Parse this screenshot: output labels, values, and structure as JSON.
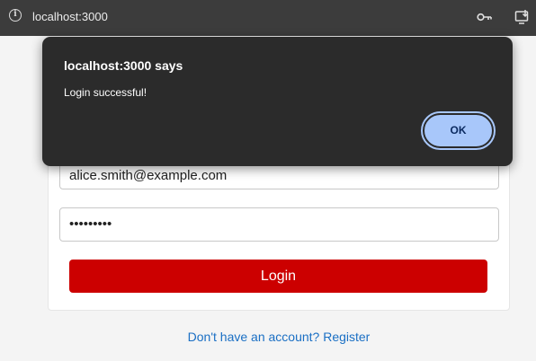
{
  "browser": {
    "url": "localhost:3000",
    "icons": [
      "info-icon",
      "key-icon",
      "install-app-icon"
    ]
  },
  "form": {
    "email_value": "alice.smith@example.com",
    "password_value": "•••••••••",
    "login_label": "Login",
    "register_link": "Don't have an account? Register"
  },
  "dialog": {
    "title": "localhost:3000 says",
    "message": "Login successful!",
    "ok_label": "OK"
  },
  "colors": {
    "login_button": "#cc0000",
    "link": "#1a6fc4",
    "dialog_bg": "#2b2b2b",
    "ok_button": "#a8c7fa"
  }
}
